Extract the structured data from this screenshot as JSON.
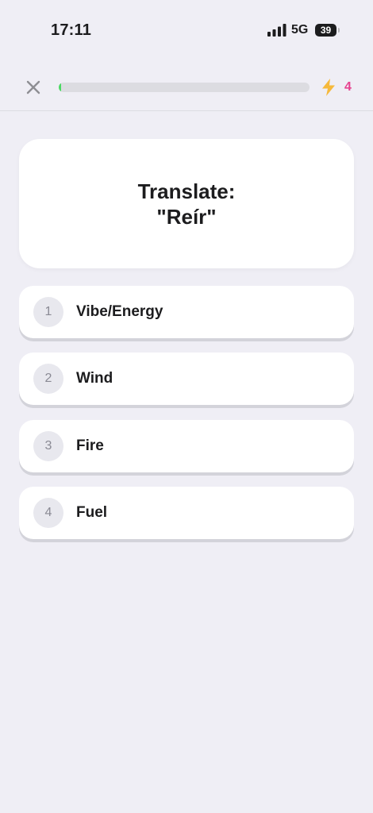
{
  "status_bar": {
    "time": "17:11",
    "network": "5G",
    "battery": "39"
  },
  "top_bar": {
    "progress": 0.01,
    "streak_count": "4",
    "streak_color": "#e6428f",
    "bolt_color": "#f6b93b",
    "progress_color": "#4cd964"
  },
  "question": {
    "title": "Translate:",
    "word": "\"Reír\""
  },
  "options": [
    {
      "number": "1",
      "label": "Vibe/Energy"
    },
    {
      "number": "2",
      "label": "Wind"
    },
    {
      "number": "3",
      "label": "Fire"
    },
    {
      "number": "4",
      "label": "Fuel"
    }
  ]
}
